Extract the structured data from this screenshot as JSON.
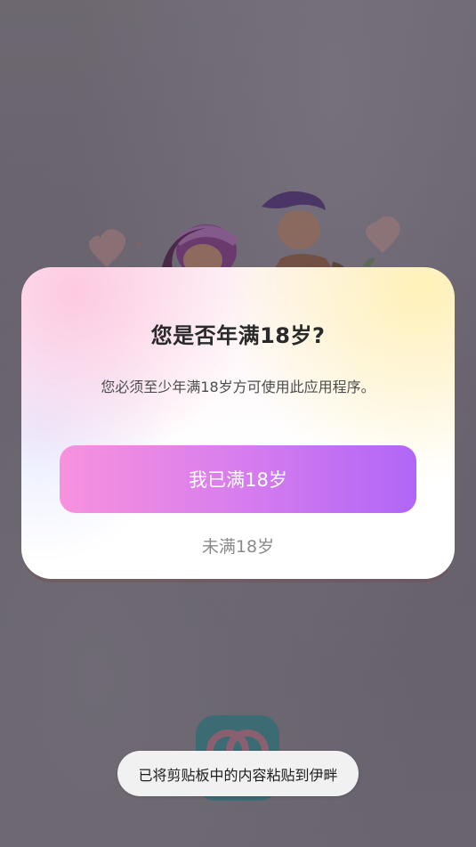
{
  "dialog": {
    "title": "您是否年满18岁?",
    "subtitle": "您必须至少年满18岁方可使用此应用程序。",
    "confirm_label": "我已满18岁",
    "decline_label": "未满18岁"
  },
  "toast": {
    "message": "已将剪贴板中的内容粘贴到伊畔"
  },
  "colors": {
    "confirm_gradient_start": "#f892de",
    "confirm_gradient_end": "#b066f7",
    "overlay": "#6a6570"
  }
}
